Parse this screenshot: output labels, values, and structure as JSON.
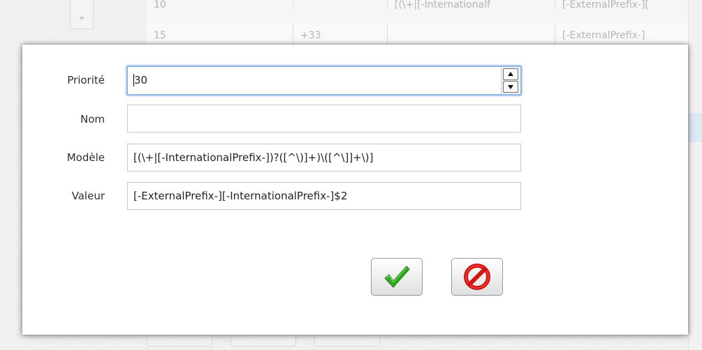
{
  "background_table": {
    "rows": [
      {
        "col1": "10",
        "col2": "",
        "col3": "[(\\+|[-Internationalf",
        "col4": "[-ExternalPrefix-]["
      },
      {
        "col1": "15",
        "col2": "+33",
        "col3": "",
        "col4": "[-ExternalPrefix-]"
      }
    ]
  },
  "dialog": {
    "fields": {
      "priorite": {
        "label": "Priorité",
        "value": "30"
      },
      "nom": {
        "label": "Nom",
        "value": ""
      },
      "modele": {
        "label": "Modèle",
        "value": "[(\\+|[-InternationalPrefix-])?([^\\)]+)\\([^\\]]+\\)]"
      },
      "valeur": {
        "label": "Valeur",
        "value": "[-ExternalPrefix-][-InternationalPrefix-]$2"
      }
    },
    "buttons": {
      "ok": {
        "icon": "checkmark-icon",
        "color": "#2ea81c"
      },
      "cancel": {
        "icon": "no-entry-icon",
        "color": "#e01818"
      }
    }
  },
  "colors": {
    "focus_border": "#8fb8e4",
    "dialog_bg": "#ffffff"
  }
}
